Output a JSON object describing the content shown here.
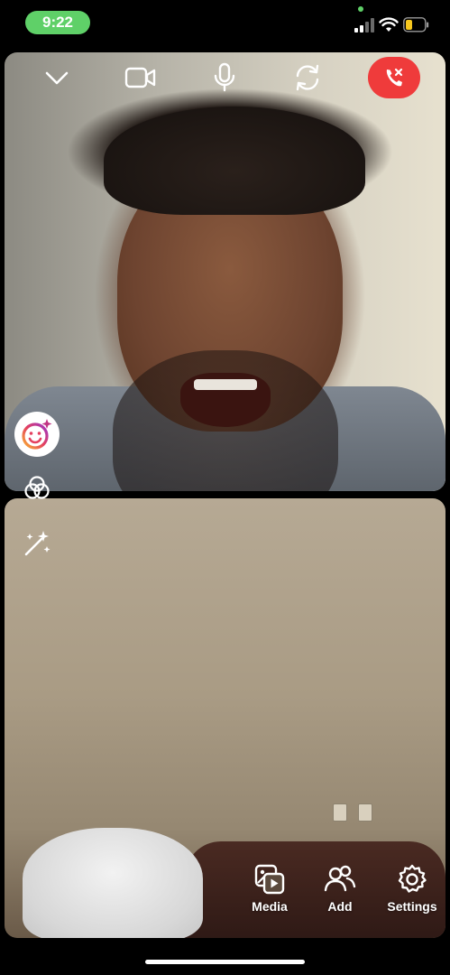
{
  "status_bar": {
    "time": "9:22",
    "accent_color": "#5fd068",
    "icons": [
      "signal-icon",
      "wifi-icon",
      "battery-icon"
    ]
  },
  "call_controls": {
    "icons": [
      "chevron-down-icon",
      "video-camera-icon",
      "microphone-icon",
      "switch-camera-icon",
      "end-call-icon"
    ],
    "end_call_color": "#ef3b3b"
  },
  "side_tools": {
    "icons": [
      "face-effects-icon",
      "filters-icon",
      "magic-wand-icon"
    ]
  },
  "bottom_actions": [
    {
      "label": "Media",
      "icon": "media-icon"
    },
    {
      "label": "Add",
      "icon": "add-people-icon"
    },
    {
      "label": "Settings",
      "icon": "settings-gear-icon"
    }
  ]
}
